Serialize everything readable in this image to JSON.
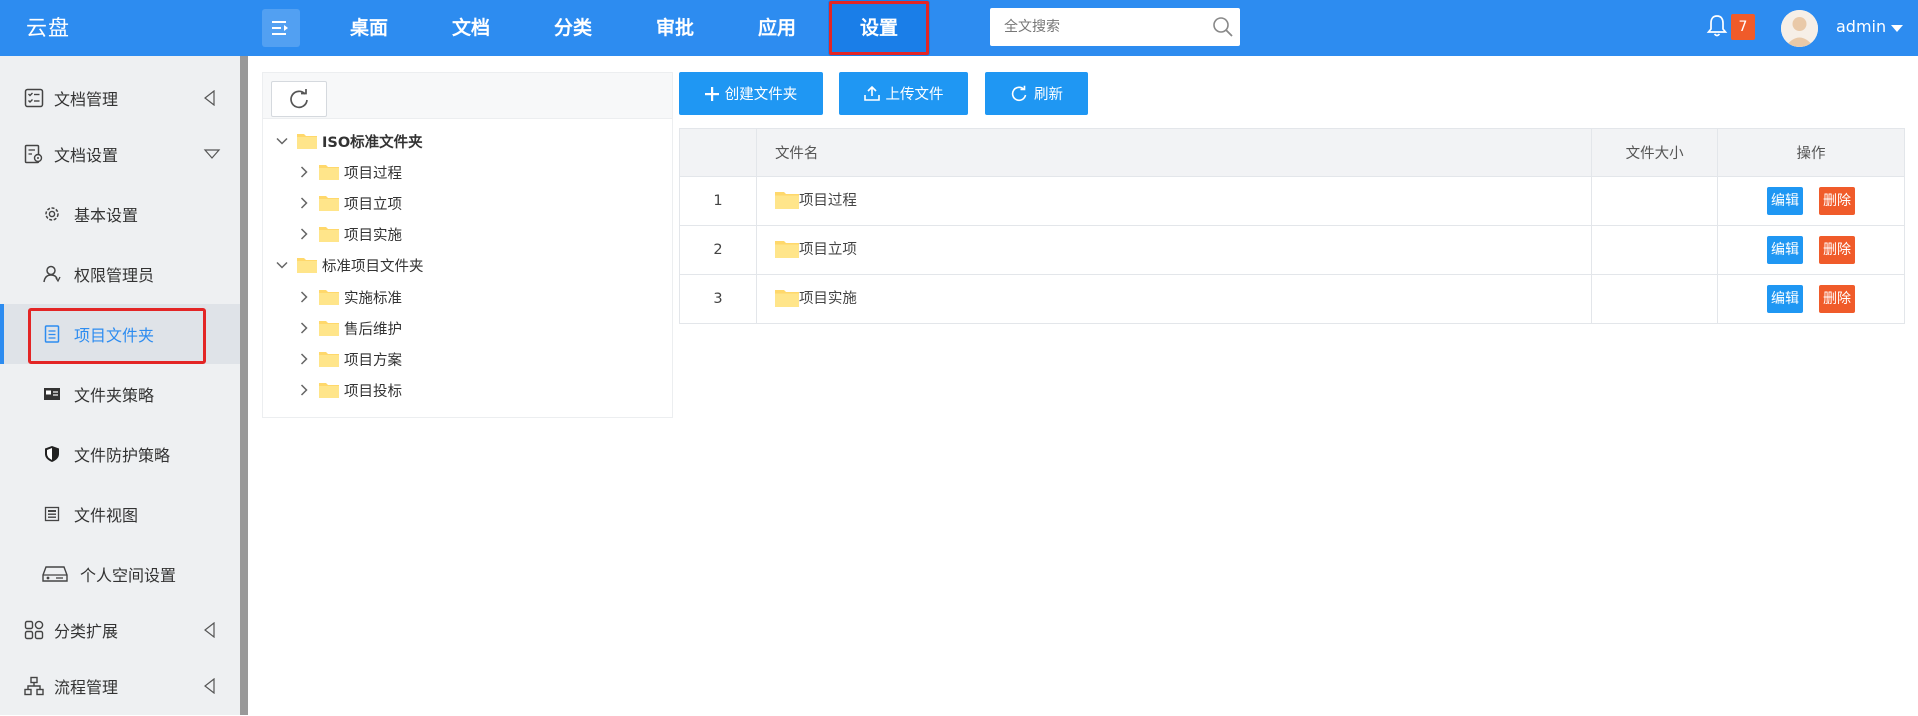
{
  "app": {
    "title": "云盘"
  },
  "colors": {
    "primary": "#2d8cf0",
    "button": "#1f97f3",
    "danger": "#f05b2a",
    "highlight": "#e32525"
  },
  "header": {
    "nav": [
      {
        "label": "桌面"
      },
      {
        "label": "文档"
      },
      {
        "label": "分类"
      },
      {
        "label": "审批"
      },
      {
        "label": "应用"
      },
      {
        "label": "设置",
        "active": true
      }
    ],
    "search": {
      "placeholder": "全文搜索",
      "icon": "search-icon"
    },
    "notifications": {
      "count": "7",
      "icon": "bell-icon"
    },
    "user": {
      "name": "admin"
    }
  },
  "sidebar": {
    "items": [
      {
        "label": "文档管理",
        "icon": "checklist-icon",
        "arrow": "collapsed"
      },
      {
        "label": "文档设置",
        "icon": "doc-settings-icon",
        "arrow": "expanded"
      },
      {
        "label": "基本设置",
        "icon": "gear-icon"
      },
      {
        "label": "权限管理员",
        "icon": "user-icon"
      },
      {
        "label": "项目文件夹",
        "icon": "list-icon",
        "active": true
      },
      {
        "label": "文件夹策略",
        "icon": "folder-policy-icon"
      },
      {
        "label": "文件防护策略",
        "icon": "shield-icon"
      },
      {
        "label": "文件视图",
        "icon": "view-icon"
      },
      {
        "label": "个人空间设置",
        "icon": "storage-icon"
      },
      {
        "label": "分类扩展",
        "icon": "grid-icon",
        "arrow": "collapsed"
      },
      {
        "label": "流程管理",
        "icon": "flow-icon",
        "arrow": "collapsed"
      }
    ]
  },
  "tree": {
    "nodes": [
      {
        "label": "ISO标准文件夹",
        "level": 0,
        "expanded": true
      },
      {
        "label": "项目过程",
        "level": 1
      },
      {
        "label": "项目立项",
        "level": 1
      },
      {
        "label": "项目实施",
        "level": 1
      },
      {
        "label": "标准项目文件夹",
        "level": 0,
        "expanded": true
      },
      {
        "label": "实施标准",
        "level": 1
      },
      {
        "label": "售后维护",
        "level": 1
      },
      {
        "label": "项目方案",
        "level": 1
      },
      {
        "label": "项目投标",
        "level": 1
      }
    ]
  },
  "toolbar": {
    "create_label": "创建文件夹",
    "upload_label": "上传文件",
    "refresh_label": "刷新"
  },
  "table": {
    "columns": [
      "",
      "文件名",
      "文件大小",
      "操作"
    ],
    "rows": [
      {
        "no": "1",
        "name": "项目过程",
        "size": ""
      },
      {
        "no": "2",
        "name": "项目立项",
        "size": ""
      },
      {
        "no": "3",
        "name": "项目实施",
        "size": ""
      }
    ],
    "edit_label": "编辑",
    "delete_label": "删除"
  }
}
